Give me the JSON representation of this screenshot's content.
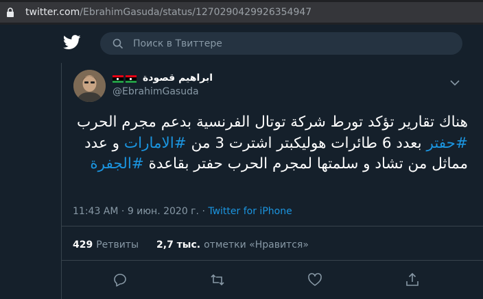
{
  "browser": {
    "url_host": "twitter.com",
    "url_path": "/EbrahimGasuda/status/1270290429926354947"
  },
  "header": {
    "search_placeholder": "Поиск в Твиттере"
  },
  "tweet": {
    "author_name": "ابراهيم قصودة",
    "author_handle": "@EbrahimGasuda",
    "text_parts": [
      {
        "t": "هناك تقارير تؤكد تورط شركة توتال الفرنسية بدعم مجرم الحرب ",
        "tag": false
      },
      {
        "t": "#حفتر",
        "tag": true
      },
      {
        "t": " بعدد 6 طائرات هوليكبتر اشترت 3 من ",
        "tag": false
      },
      {
        "t": "#الامارات",
        "tag": true
      },
      {
        "t": " و عدد مماثل من تشاد و سلمتها لمجرم الحرب حفتر بقاعدة ",
        "tag": false
      },
      {
        "t": "#الجفرة",
        "tag": true
      }
    ],
    "time": "11:43 AM",
    "sep": " · ",
    "date": "9 июн. 2020 г.",
    "source": "Twitter for iPhone",
    "retweets_count": "429",
    "retweets_label": "Ретвиты",
    "likes_count": "2,7 тыс.",
    "likes_label": "отметки «Нравится»"
  },
  "icons": {
    "lock": "lock-icon",
    "bird": "twitter-bird-icon",
    "search": "search-icon",
    "caret": "chevron-down-icon",
    "reply": "reply-icon",
    "retweet": "retweet-icon",
    "like": "heart-icon",
    "share": "share-icon"
  },
  "colors": {
    "background": "#15202b",
    "accent": "#1b95e0",
    "secondary_text": "#8899a6",
    "border": "#38444d"
  }
}
